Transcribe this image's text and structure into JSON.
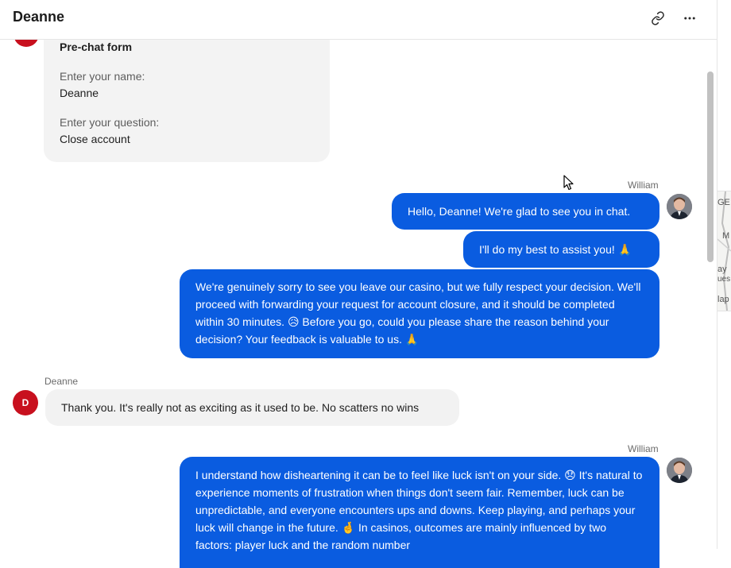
{
  "header": {
    "title": "Deanne",
    "link_icon": "link-icon",
    "more_icon": "more-horizontal-icon"
  },
  "form": {
    "title": "Pre-chat form",
    "name_label": "Enter your name:",
    "name_value": "Deanne",
    "question_label": "Enter your question:",
    "question_value": "Close account"
  },
  "messages": {
    "agent_name": "William",
    "visitor_name": "Deanne",
    "visitor_initial": "D",
    "m1": "Hello, Deanne! We're glad to see you in chat.",
    "m2": "I'll do my best to assist you! 🙏",
    "m3": "We're genuinely sorry to see you leave our casino, but we fully respect your decision. We'll proceed with forwarding your request for account closure, and it should be completed within 30 minutes. 😥 Before you go, could you please share the reason behind your decision? Your feedback is valuable to us. 🙏",
    "m4": "Thank you. It's really not as exciting as it used to be. No scatters no wins",
    "m5": "I understand how disheartening it can be to feel like luck isn't on your side. 😞 It's natural to experience moments of frustration when things don't seem fair. Remember, luck can be unpredictable, and everyone encounters ups and downs. Keep playing, and perhaps your luck will change in the future. 🤞 In casinos, outcomes are mainly influenced by two factors: player luck and the random number"
  },
  "map_fragments": [
    "GE",
    "M",
    "ay",
    "ues",
    "lap"
  ],
  "colors": {
    "agent_bubble": "#0a5ce0",
    "visitor_bubble": "#f2f2f2",
    "visitor_avatar": "#c8101e"
  }
}
